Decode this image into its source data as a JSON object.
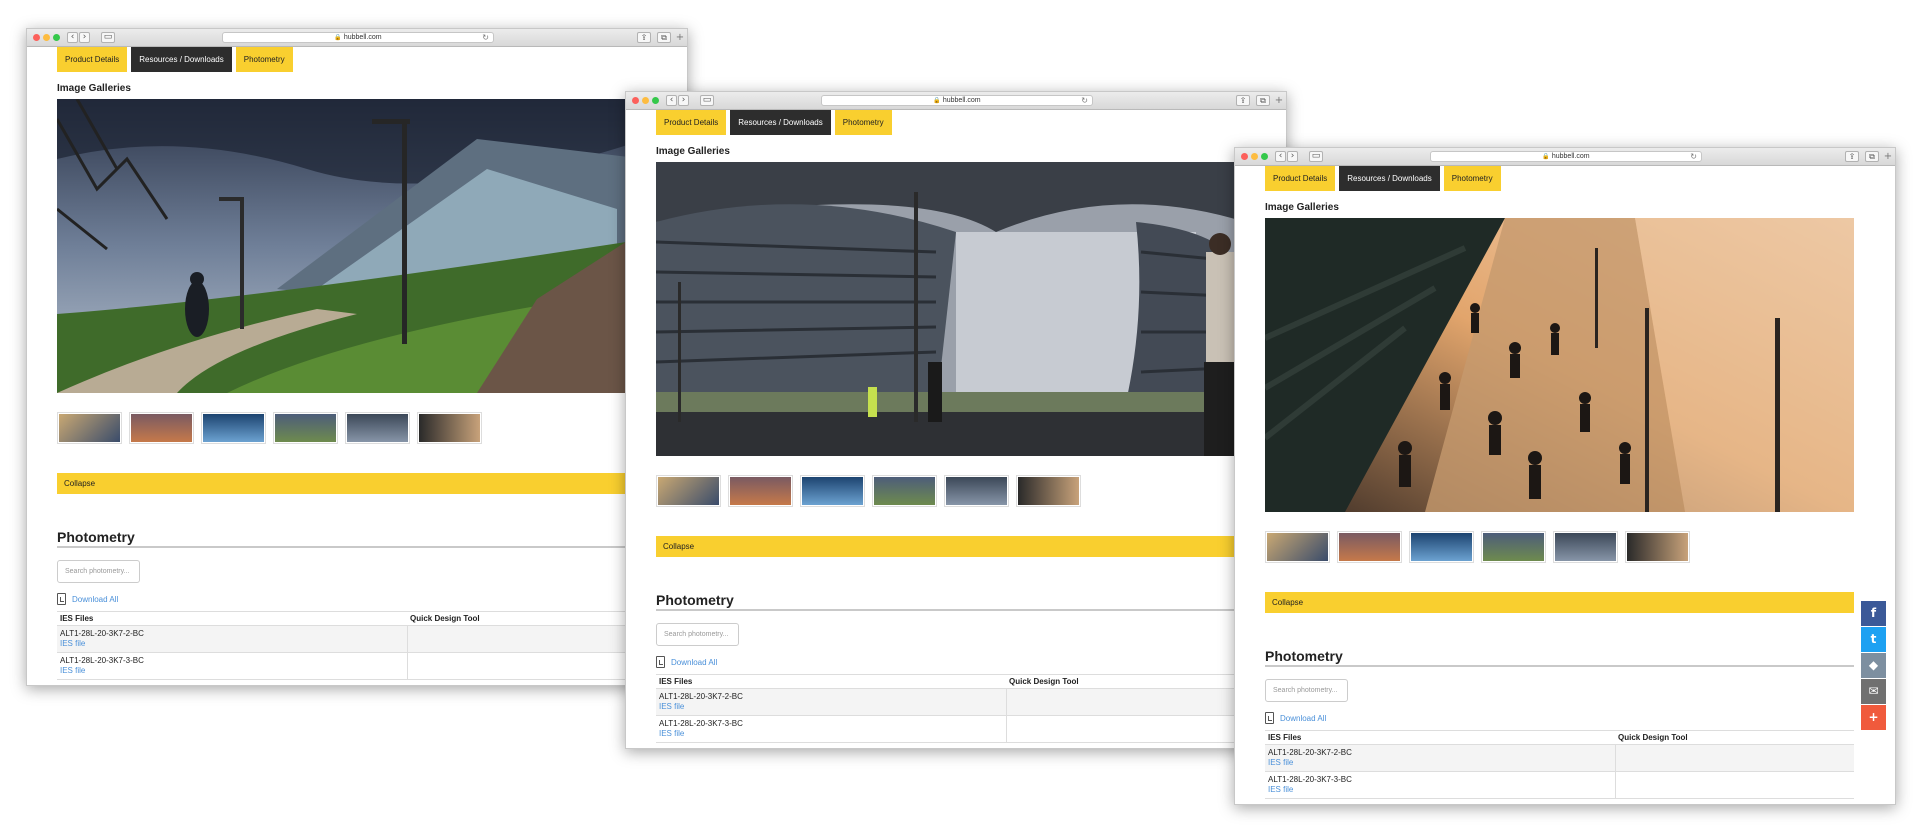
{
  "browser": {
    "url": "hubbell.com",
    "nav_back": "‹",
    "nav_forward": "›",
    "sidebar_icon": "▭",
    "share_icon": "⇪",
    "tabs_icon": "⧉",
    "new_tab": "+"
  },
  "page": {
    "tabs": {
      "product_details": "Product Details",
      "resources_downloads": "Resources / Downloads",
      "photometry": "Photometry"
    },
    "gallery_title": "Image Galleries",
    "collapse_label": "Collapse",
    "photometry_title": "Photometry",
    "search_placeholder": "Search photometry...",
    "download_all": "Download All",
    "table": {
      "headers": [
        "IES Files",
        "Quick Design Tool"
      ],
      "rows": [
        {
          "name": "ALT1-28L-20-3K7-2-BC",
          "link": "IES file"
        },
        {
          "name": "ALT1-28L-20-3K7-3-BC",
          "link": "IES file"
        }
      ]
    }
  },
  "windows": [
    {
      "hero_scene": "runner-path-building-dusk"
    },
    {
      "hero_scene": "curved-glass-building-plaza"
    },
    {
      "hero_scene": "riverside-crowd-sunset"
    }
  ],
  "social": {
    "facebook": "f",
    "twitter": "t",
    "share": "◆",
    "email": "✉",
    "more": "+"
  },
  "colors": {
    "accent_yellow": "#f9cf2f",
    "dark_tab": "#2d2d2d",
    "link_blue": "#4a90d9"
  }
}
